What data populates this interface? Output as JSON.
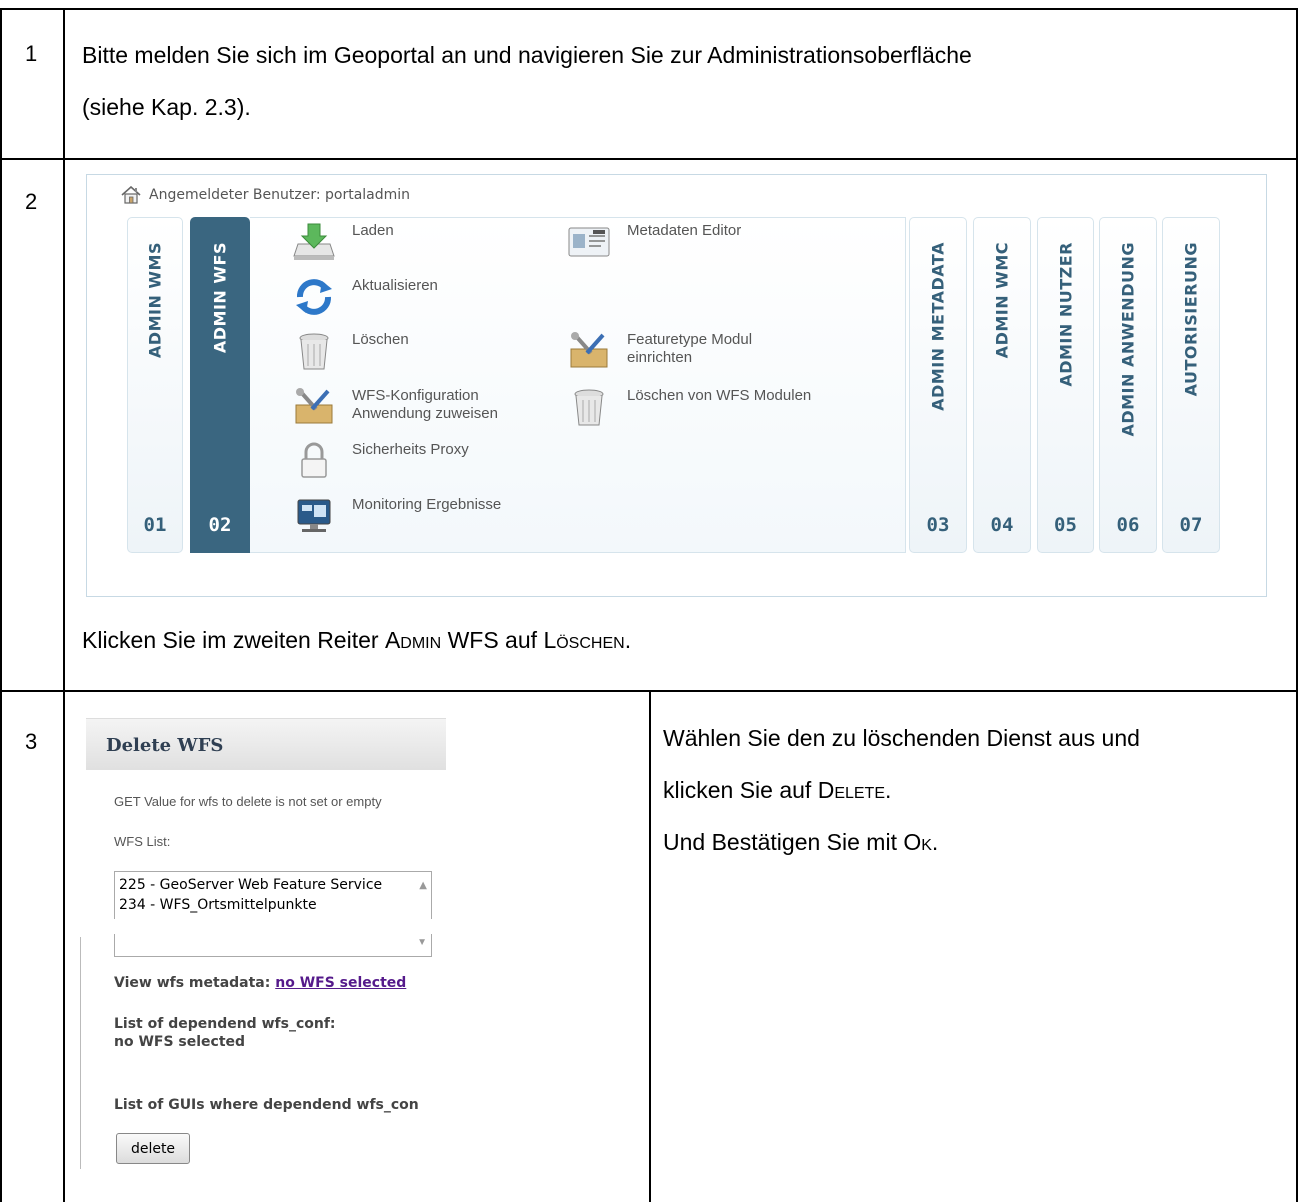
{
  "steps": [
    {
      "num": "1",
      "text_line1": "Bitte melden Sie sich im Geoportal an und navigieren Sie zur Administrationsoberfläche",
      "text_line2": "(siehe Kap. 2.3)."
    },
    {
      "num": "2",
      "caption_prefix": "Klicken Sie im zweiten Reiter ",
      "caption_tab": "Admin WFS",
      "caption_mid": " auf ",
      "caption_action": "Löschen",
      "caption_suffix": "."
    },
    {
      "num": "3",
      "text_line1": "Wählen Sie den zu löschenden Dienst aus und",
      "text_line2_prefix": "klicken Sie auf ",
      "text_line2_action": "Delete",
      "text_line2_suffix": ".",
      "text_line3_prefix": "Und Bestätigen Sie mit ",
      "text_line3_action": "Ok",
      "text_line3_suffix": "."
    }
  ],
  "admin_panel": {
    "user_label": "Angemeldeter Benutzer: portaladmin",
    "tabs": [
      {
        "label": "ADMIN WMS",
        "num": "01"
      },
      {
        "label": "ADMIN WFS",
        "num": "02",
        "active": true
      },
      {
        "label": "ADMIN METADATA",
        "num": "03"
      },
      {
        "label": "ADMIN WMC",
        "num": "04"
      },
      {
        "label": "ADMIN NUTZER",
        "num": "05"
      },
      {
        "label": "ADMIN ANWENDUNG",
        "num": "06"
      },
      {
        "label": "AUTORISIERUNG",
        "num": "07"
      }
    ],
    "menu": {
      "laden": "Laden",
      "aktualisieren": "Aktualisieren",
      "loeschen": "Löschen",
      "wfs_konf_1": "WFS-Konfiguration",
      "wfs_konf_2": "Anwendung zuweisen",
      "sicherheits_proxy": "Sicherheits Proxy",
      "monitoring": "Monitoring Ergebnisse",
      "metadaten_editor": "Metadaten Editor",
      "featuretype_1": "Featuretype Modul",
      "featuretype_2": "einrichten",
      "loeschen_module": "Löschen von WFS Modulen"
    }
  },
  "delete_wfs": {
    "title": "Delete WFS",
    "notice": "GET Value for wfs to delete is not set or empty",
    "list_label": "WFS List:",
    "list_items": [
      "225 - GeoServer Web Feature Service",
      "234 - WFS_Ortsmittelpunkte"
    ],
    "view_meta_label": "View wfs metadata: ",
    "view_meta_link": "no WFS selected",
    "dependend_conf_label": "List of dependend wfs_conf:",
    "dependend_conf_value": "no WFS selected",
    "gui_label": "List of GUIs where dependend wfs_con",
    "delete_button": "delete"
  }
}
